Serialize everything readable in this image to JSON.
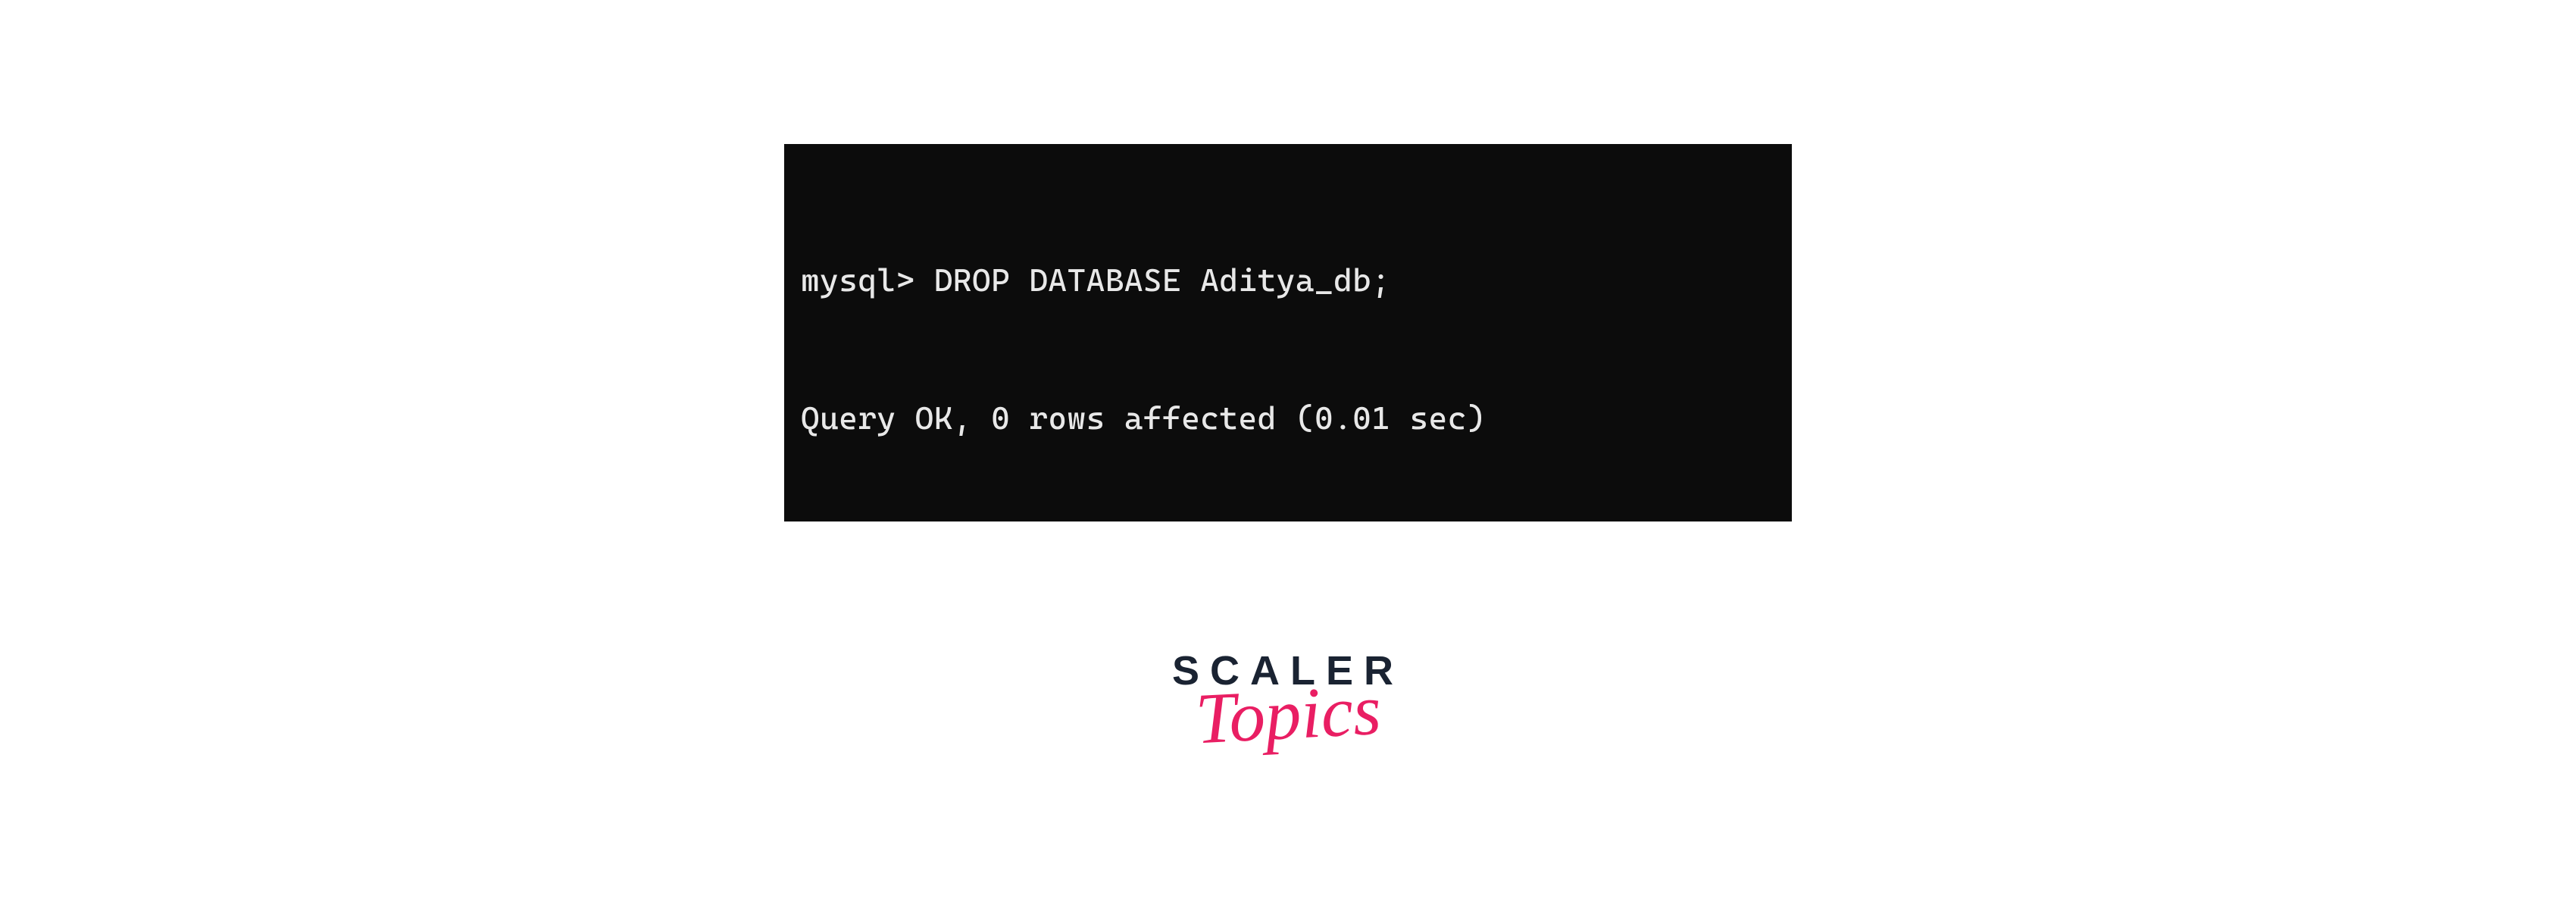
{
  "terminal": {
    "lines": [
      "mysql> DROP DATABASE Aditya_db;",
      "Query OK, 0 rows affected (0.01 sec)"
    ]
  },
  "logo": {
    "primary_text": "SCALER",
    "secondary_text": "Topics",
    "primary_color": "#1a2332",
    "accent_color": "#e91e63"
  }
}
